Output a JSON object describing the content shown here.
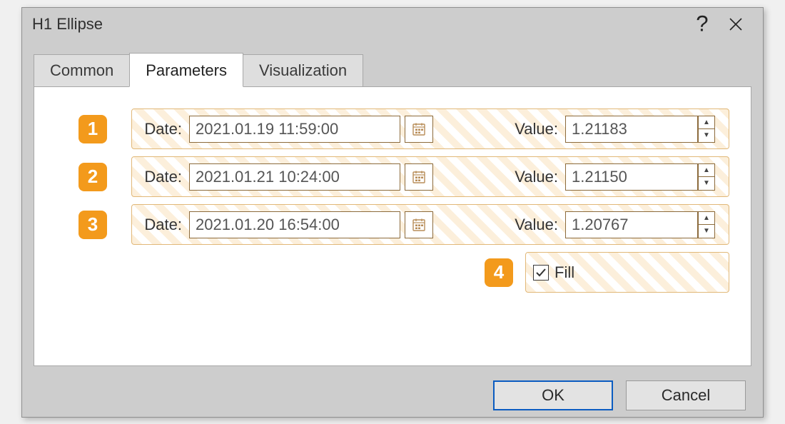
{
  "title": "H1 Ellipse",
  "tabs": {
    "common": "Common",
    "parameters": "Parameters",
    "visualization": "Visualization"
  },
  "labels": {
    "date": "Date:",
    "value": "Value:",
    "fill": "Fill"
  },
  "rows": [
    {
      "n": "1",
      "date": "2021.01.19 11:59:00",
      "value": "1.21183"
    },
    {
      "n": "2",
      "date": "2021.01.21 10:24:00",
      "value": "1.21150"
    },
    {
      "n": "3",
      "date": "2021.01.20 16:54:00",
      "value": "1.20767"
    }
  ],
  "badge4": "4",
  "fill_checked": true,
  "buttons": {
    "ok": "OK",
    "cancel": "Cancel"
  }
}
